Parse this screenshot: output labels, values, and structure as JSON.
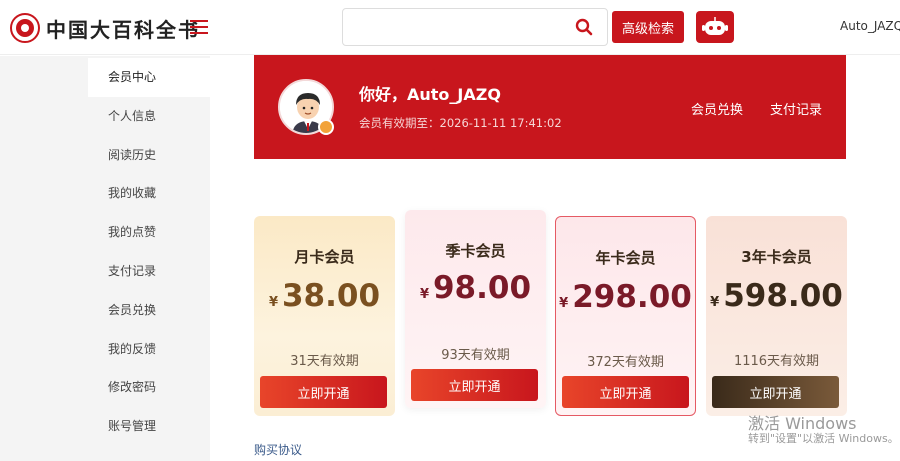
{
  "header": {
    "logo_text": "中国大百科全书",
    "search_placeholder": "",
    "advanced_search_label": "高级检索",
    "username": "Auto_JAZQ"
  },
  "sidebar": {
    "items": [
      {
        "label": "会员中心",
        "active": true
      },
      {
        "label": "个人信息"
      },
      {
        "label": "阅读历史"
      },
      {
        "label": "我的收藏"
      },
      {
        "label": "我的点赞"
      },
      {
        "label": "支付记录"
      },
      {
        "label": "会员兑换"
      },
      {
        "label": "我的反馈"
      },
      {
        "label": "修改密码"
      },
      {
        "label": "账号管理"
      }
    ]
  },
  "banner": {
    "greeting": "你好，Auto_JAZQ",
    "expiry": "会员有效期至：2026-11-11 17:41:02",
    "links": [
      "会员兑换",
      "支付记录"
    ]
  },
  "plans": [
    {
      "title": "月卡会员",
      "currency": "¥",
      "price": "38.00",
      "validity": "31天有效期",
      "button": "立即开通"
    },
    {
      "title": "季卡会员",
      "currency": "¥",
      "price": "98.00",
      "validity": "93天有效期",
      "button": "立即开通"
    },
    {
      "title": "年卡会员",
      "currency": "¥",
      "price": "298.00",
      "validity": "372天有效期",
      "button": "立即开通"
    },
    {
      "title": "3年卡会员",
      "currency": "¥",
      "price": "598.00",
      "validity": "1116天有效期",
      "button": "立即开通"
    }
  ],
  "agreement_label": "购买协议",
  "watermark": {
    "line1": "激活 Windows",
    "line2": "转到\"设置\"以激活 Windows。"
  },
  "colors": {
    "brand_red": "#c8161d",
    "price_month": "#7a5020",
    "price_quarter": "#7a1a28",
    "price_year": "#7a1a28",
    "price_3year": "#3a2a1a"
  }
}
